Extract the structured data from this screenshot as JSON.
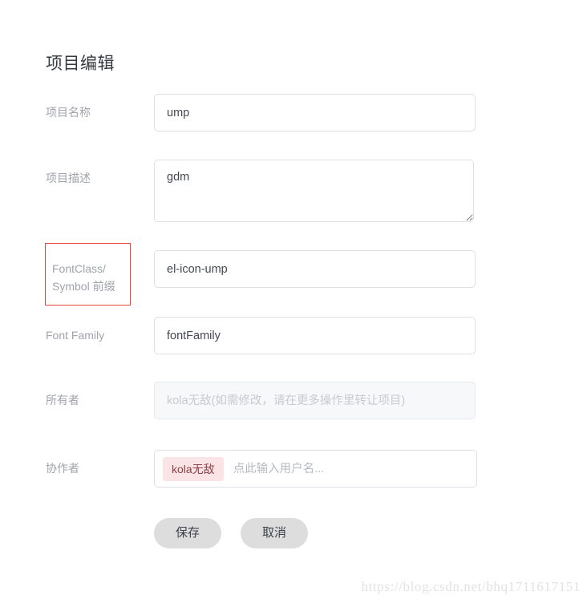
{
  "page": {
    "title": "项目编辑"
  },
  "form": {
    "fields": [
      {
        "key": "project_name",
        "label": "项目名称",
        "type": "input",
        "value": "ump",
        "placeholder": "",
        "disabled": false,
        "highlighted": false
      },
      {
        "key": "project_description",
        "label": "项目描述",
        "type": "textarea",
        "value": "gdm",
        "placeholder": "",
        "disabled": false,
        "highlighted": false
      },
      {
        "key": "fontclass_symbol_prefix",
        "label_line1": "FontClass/",
        "label_line2": "Symbol 前缀",
        "type": "input",
        "value": "el-icon-ump",
        "placeholder": "",
        "disabled": false,
        "highlighted": true,
        "highlight_color": "#e8443a"
      },
      {
        "key": "font_family",
        "label": "Font Family",
        "type": "input",
        "value": "fontFamily",
        "placeholder": "",
        "disabled": false,
        "highlighted": false
      },
      {
        "key": "owner",
        "label": "所有者",
        "type": "input",
        "value": "",
        "placeholder": "kola无敌(如需修改，请在更多操作里转让项目)",
        "disabled": true,
        "highlighted": false
      },
      {
        "key": "collaborators",
        "label": "协作者",
        "type": "tags",
        "tags": [
          "kola无敌"
        ],
        "placeholder": "点此输入用户名...",
        "disabled": false,
        "highlighted": false
      }
    ]
  },
  "actions": {
    "save_label": "保存",
    "cancel_label": "取消"
  },
  "watermark": {
    "text": "https://blog.csdn.net/bhq1711617151"
  },
  "colors": {
    "label": "#9fa3aa",
    "title": "#343a40",
    "border": "#dcdfe6",
    "highlight": "#e8443a",
    "tag_bg": "#fbe4e5",
    "tag_text": "#8f4249",
    "button_bg": "#dddddd",
    "disabled_bg": "#f7f8fa"
  }
}
